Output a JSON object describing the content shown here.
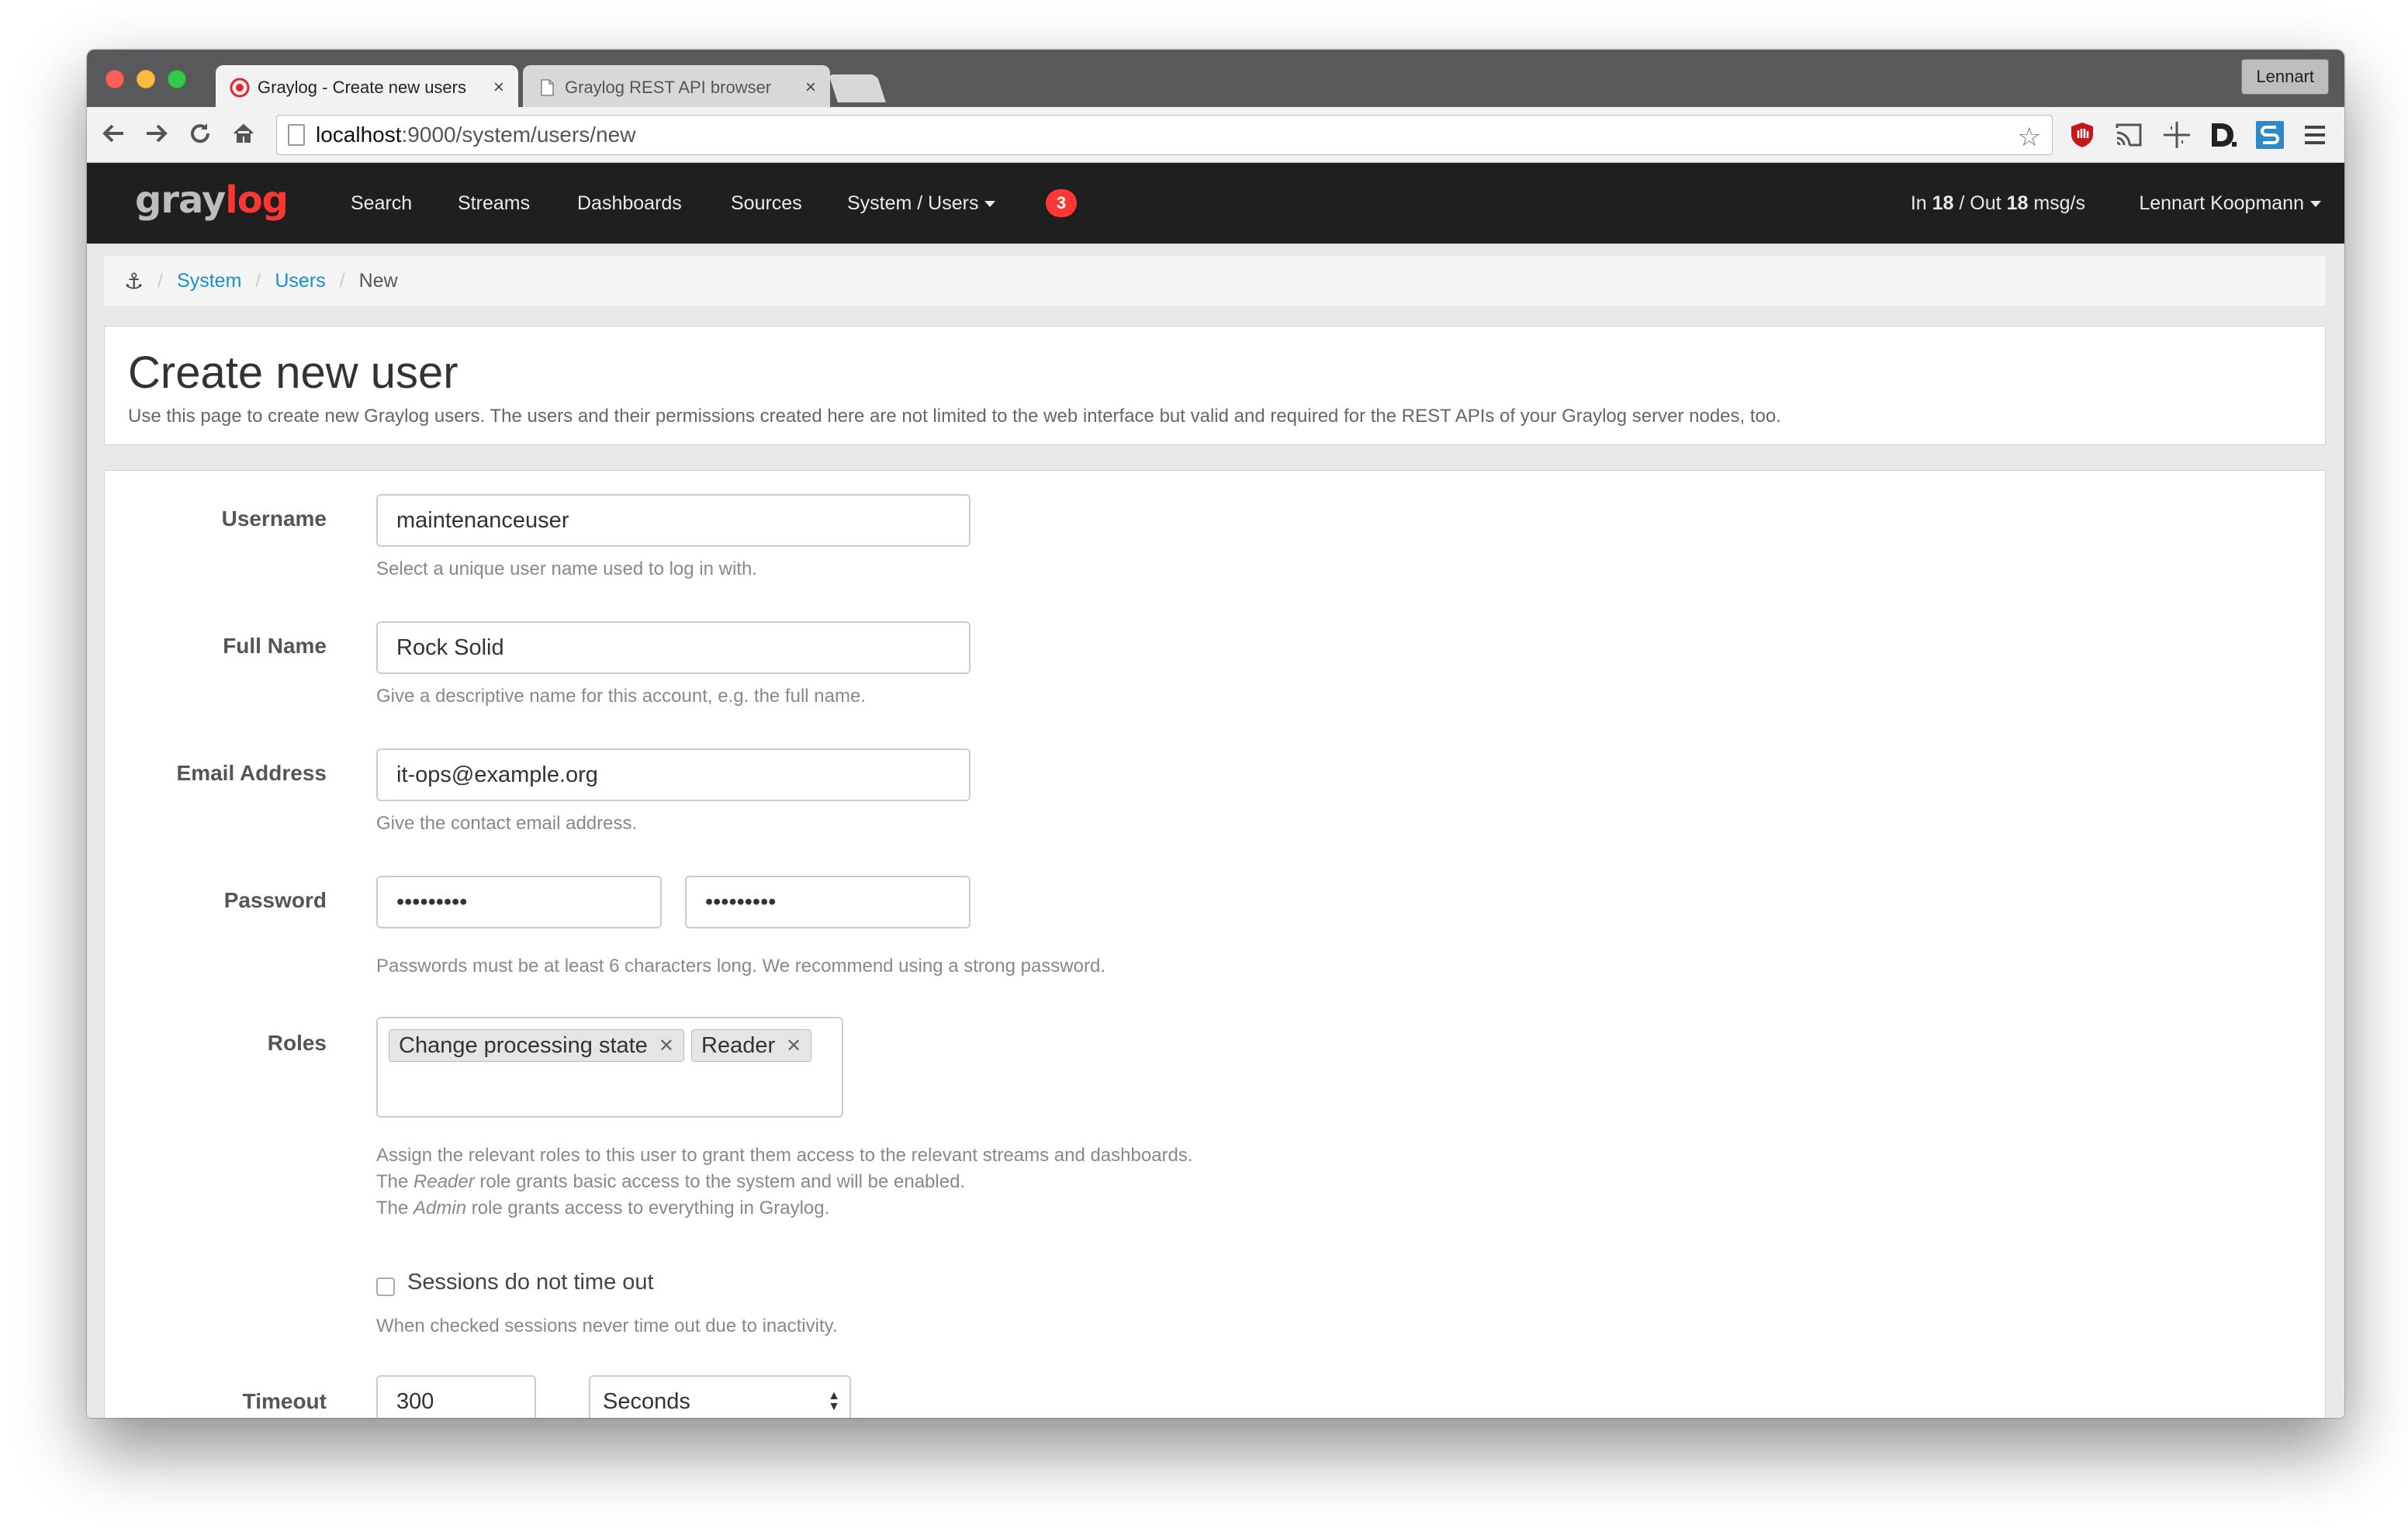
{
  "browser": {
    "profile_name": "Lennart",
    "tabs": [
      {
        "title": "Graylog - Create new users",
        "close": "×"
      },
      {
        "title": "Graylog REST API browser",
        "close": "×"
      }
    ],
    "url_host": "localhost",
    "url_path": ":9000/system/users/new"
  },
  "nav": {
    "logo_gray": "gray",
    "logo_red": "log",
    "items": [
      "Search",
      "Streams",
      "Dashboards",
      "Sources",
      "System / Users"
    ],
    "notification_count": "3",
    "throughput_in_label": "In ",
    "throughput_in": "18",
    "throughput_out_label": " / Out ",
    "throughput_out": "18",
    "throughput_unit": " msg/s",
    "user_name": "Lennart Koopmann"
  },
  "breadcrumb": {
    "home_icon": "⚓",
    "items": [
      "System",
      "Users",
      "New"
    ]
  },
  "page": {
    "title": "Create new user",
    "description": "Use this page to create new Graylog users. The users and their permissions created here are not limited to the web interface but valid and required for the REST APIs of your Graylog server nodes, too."
  },
  "form": {
    "username": {
      "label": "Username",
      "value": "maintenanceuser",
      "help": "Select a unique user name used to log in with."
    },
    "full_name": {
      "label": "Full Name",
      "value": "Rock Solid",
      "help": "Give a descriptive name for this account, e.g. the full name."
    },
    "email": {
      "label": "Email Address",
      "value": "it-ops@example.org",
      "help": "Give the contact email address."
    },
    "password": {
      "label": "Password",
      "value": "•••••••••",
      "confirm_value": "•••••••••",
      "help": "Passwords must be at least 6 characters long. We recommend using a strong password."
    },
    "roles": {
      "label": "Roles",
      "tags": [
        "Change processing state",
        "Reader"
      ],
      "help_line1": "Assign the relevant roles to this user to grant them access to the relevant streams and dashboards.",
      "help_line2_pre": "The ",
      "help_line2_em": "Reader",
      "help_line2_post": " role grants basic access to the system and will be enabled.",
      "help_line3_pre": "The ",
      "help_line3_em": "Admin",
      "help_line3_post": " role grants access to everything in Graylog."
    },
    "sessions": {
      "label": "Sessions do not time out",
      "checked": false,
      "help": "When checked sessions never time out due to inactivity."
    },
    "timeout": {
      "label": "Timeout",
      "value": "300",
      "unit": "Seconds"
    }
  },
  "colors": {
    "accent_red": "#ff3633",
    "link_blue": "#1a8fc9",
    "nav_bg": "#1f1f1f"
  }
}
